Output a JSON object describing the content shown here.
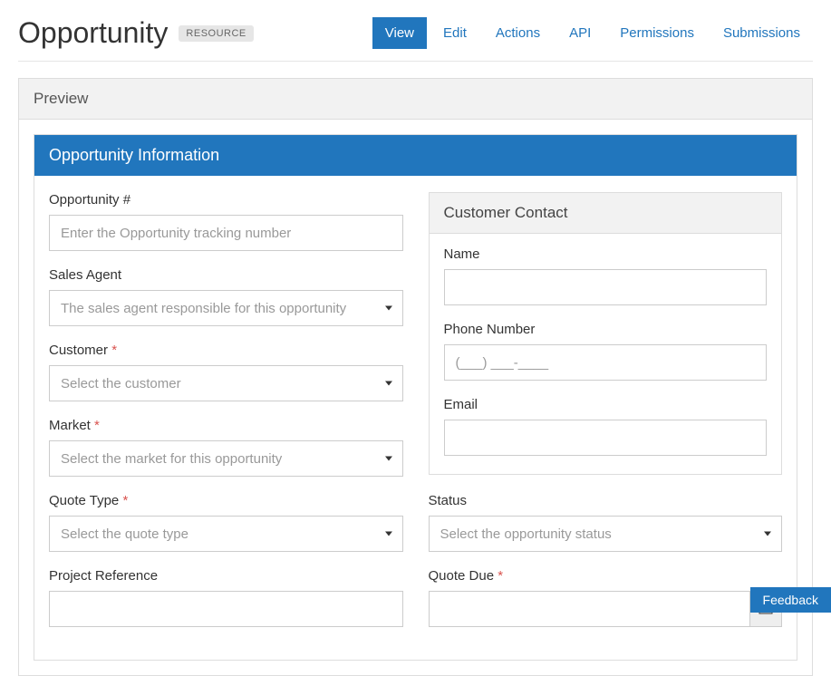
{
  "header": {
    "title": "Opportunity",
    "badge": "RESOURCE"
  },
  "nav": {
    "view": "View",
    "edit": "Edit",
    "actions": "Actions",
    "api": "API",
    "permissions": "Permissions",
    "submissions": "Submissions"
  },
  "preview": {
    "title": "Preview"
  },
  "form": {
    "section_title": "Opportunity Information",
    "opportunity_num": {
      "label": "Opportunity #",
      "placeholder": "Enter the Opportunity tracking number"
    },
    "sales_agent": {
      "label": "Sales Agent",
      "placeholder": "The sales agent responsible for this opportunity"
    },
    "customer": {
      "label": "Customer",
      "required": "*",
      "placeholder": "Select the customer"
    },
    "market": {
      "label": "Market",
      "required": "*",
      "placeholder": "Select the market for this opportunity"
    },
    "quote_type": {
      "label": "Quote Type",
      "required": "*",
      "placeholder": "Select the quote type"
    },
    "project_ref": {
      "label": "Project Reference"
    },
    "contact": {
      "title": "Customer Contact",
      "name": {
        "label": "Name"
      },
      "phone": {
        "label": "Phone Number",
        "placeholder": "(___) ___-____"
      },
      "email": {
        "label": "Email"
      }
    },
    "status": {
      "label": "Status",
      "placeholder": "Select the opportunity status"
    },
    "quote_due": {
      "label": "Quote Due",
      "required": "*"
    }
  },
  "feedback": "Feedback"
}
